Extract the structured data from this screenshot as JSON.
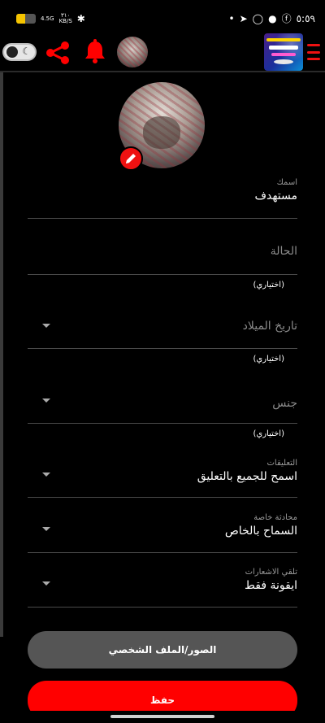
{
  "status_bar": {
    "time": "٥:٥٩",
    "network_speed_top": "4.5G",
    "network_speed_value": "٣١٠",
    "network_speed_unit": "KB/S",
    "battery_level": 0.45
  },
  "topbar": {
    "theme_toggle_state": "dark",
    "colors": {
      "accent": "#ff0000",
      "menu": "#ee1111"
    }
  },
  "profile": {
    "name_label": "اسمك",
    "name_value": "مستهدف",
    "status_placeholder": "الحالة",
    "optional_text": "(اختياري)",
    "birthdate_placeholder": "تاريخ الميلاد",
    "gender_placeholder": "جنس",
    "comments_label": "التعليقات",
    "comments_value": "اسمح للجميع بالتعليق",
    "private_chat_label": "محادثة خاصة",
    "private_chat_value": "السماح بالخاص",
    "notifications_label": "تلقي الاشعارات",
    "notifications_value": "ايقونة فقط"
  },
  "buttons": {
    "photos_label": "الصور/الملف الشخصي",
    "save_label": "حفظ"
  }
}
